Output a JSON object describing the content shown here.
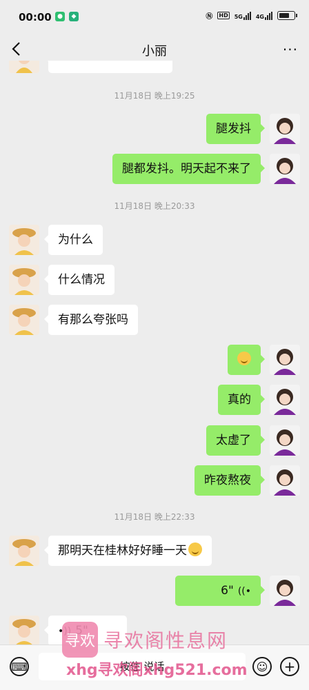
{
  "status": {
    "time": "00:00",
    "network": "5G",
    "network2": "4G",
    "hd": "HD"
  },
  "nav": {
    "title": "小丽",
    "more": "···"
  },
  "chat": {
    "partial_top": "",
    "ts1": "11月18日 晚上19:25",
    "m1": "腿发抖",
    "m2": "腿都发抖。明天起不来了",
    "ts2": "11月18日 晚上20:33",
    "m3": "为什么",
    "m4": "什么情况",
    "m5": "有那么夸张吗",
    "m6_emoji": "laughing-crying-emoji",
    "m7": "真的",
    "m8": "太虚了",
    "m9": "昨夜熬夜",
    "ts3": "11月18日 晚上22:33",
    "m10": "那明天在桂林好好睡一天",
    "m11_voice": "6\"",
    "m12_partial": "5\""
  },
  "input": {
    "mode": "按住 说话"
  },
  "watermark": {
    "logo": "寻欢",
    "name": "寻欢阁性息网",
    "url": "xhg寻欢阁xhg521.com"
  },
  "colors": {
    "outgoing": "#95ec69",
    "incoming": "#ffffff",
    "background": "#ededed",
    "watermark": "#e8709d"
  }
}
